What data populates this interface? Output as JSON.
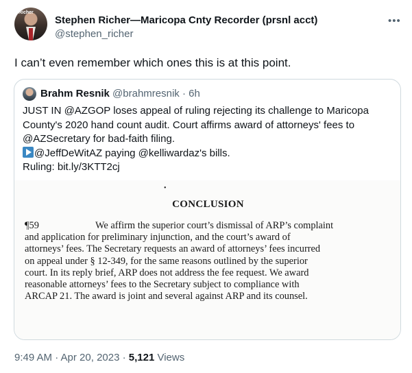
{
  "author": {
    "name": "Stephen Richer—Maricopa Cnty Recorder (prsnl acct)",
    "handle": "@stephen_richer",
    "avatar_tag": "Richer"
  },
  "more_icon": "more-horizontal-icon",
  "tweet_text": "I can’t even remember which ones this is at this point.",
  "quote": {
    "name": "Brahm Resnik",
    "handle_time": "@brahmresnik · 6h",
    "lines": [
      "JUST IN @AZGOP loses appeal of ruling rejecting its challenge to Maricopa",
      "County's 2020 hand count audit. Court affirms award of attorneys' fees to",
      "@AZSecretary for bad-faith filing."
    ],
    "play_line": "@JeffDeWitAZ paying @kelliwardaz's bills.",
    "ruling_line": "Ruling: bit.ly/3KTT2cj"
  },
  "document": {
    "mark": "•",
    "title": "CONCLUSION",
    "para_num": "¶59",
    "first_line": "We affirm the superior court’s dismissal of ARP’s complaint",
    "lines": [
      "and application for preliminary injunction, and the court’s award of",
      "attorneys’ fees. The Secretary requests an award of attorneys’ fees incurred",
      "on appeal under § 12-349, for the same reasons outlined by the superior",
      "court. In its reply brief, ARP does not address the fee request. We award",
      "reasonable attorneys’ fees to the Secretary subject to compliance with",
      "ARCAP 21. The award is joint and several against ARP and its counsel."
    ]
  },
  "meta": {
    "time_date": "9:49 AM · Apr 20, 2023 · ",
    "views_count": "5,121",
    "views_label": " Views"
  }
}
